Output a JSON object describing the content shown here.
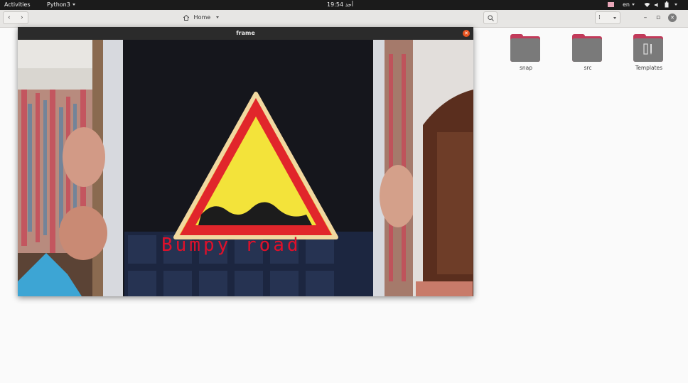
{
  "topbar": {
    "activities": "Activities",
    "app_menu": "Python3",
    "clock": "19:54 أحد",
    "lang": "en",
    "tray_icons": [
      "screen-share-icon",
      "wifi-icon",
      "sound-icon",
      "battery-icon",
      "system-menu-chevron-icon"
    ]
  },
  "files": {
    "location": "Home",
    "folders": [
      {
        "name": "snap"
      },
      {
        "name": "src"
      },
      {
        "name": "Templates"
      }
    ]
  },
  "frame_window": {
    "title": "frame",
    "detection_label": "Bumpy road"
  },
  "colors": {
    "accent": "#e95420",
    "folder_tab": "#c23a5a",
    "label": "#e0102a"
  }
}
